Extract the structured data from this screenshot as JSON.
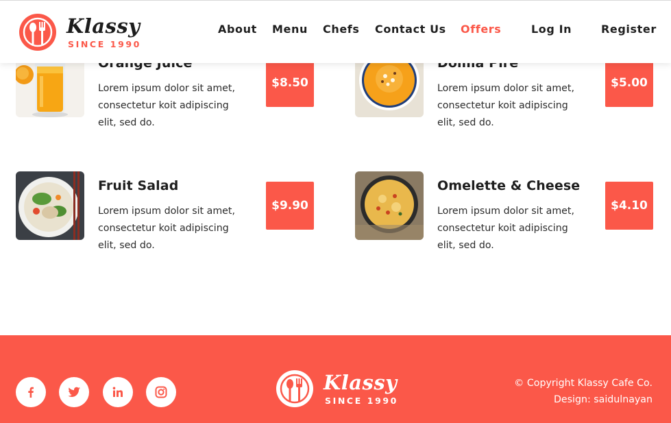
{
  "header": {
    "brand": {
      "name": "Klassy",
      "tagline": "SINCE 1990"
    },
    "nav": [
      {
        "label": "About",
        "active": false
      },
      {
        "label": "Menu",
        "active": false
      },
      {
        "label": "Chefs",
        "active": false
      },
      {
        "label": "Contact Us",
        "active": false
      },
      {
        "label": "Offers",
        "active": true
      },
      {
        "label": "Log In",
        "active": false
      },
      {
        "label": "Register",
        "active": false
      }
    ]
  },
  "menu": {
    "items": [
      {
        "title": "Orange Juice",
        "description": "Lorem ipsum dolor sit amet, consectetur koit adipiscing elit, sed do.",
        "price": "$8.50",
        "image": "orange-juice-photo"
      },
      {
        "title": "Dolma Pire",
        "description": "Lorem ipsum dolor sit amet, consectetur koit adipiscing elit, sed do.",
        "price": "$5.00",
        "image": "soup-bowl-photo"
      },
      {
        "title": "Fruit Salad",
        "description": "Lorem ipsum dolor sit amet, consectetur koit adipiscing elit, sed do.",
        "price": "$9.90",
        "image": "salad-bowl-photo"
      },
      {
        "title": "Omelette & Cheese",
        "description": "Lorem ipsum dolor sit amet, consectetur koit adipiscing elit, sed do.",
        "price": "$4.10",
        "image": "omelette-pan-photo"
      }
    ]
  },
  "footer": {
    "social": [
      "facebook-icon",
      "twitter-icon",
      "linkedin-icon",
      "instagram-icon"
    ],
    "brand": {
      "name": "Klassy",
      "tagline": "SINCE 1990"
    },
    "copyright": "© Copyright Klassy Cafe Co.",
    "design": "Design: saidulnayan"
  },
  "colors": {
    "accent": "#fb5849",
    "text": "#1e1e1e",
    "white": "#ffffff"
  }
}
